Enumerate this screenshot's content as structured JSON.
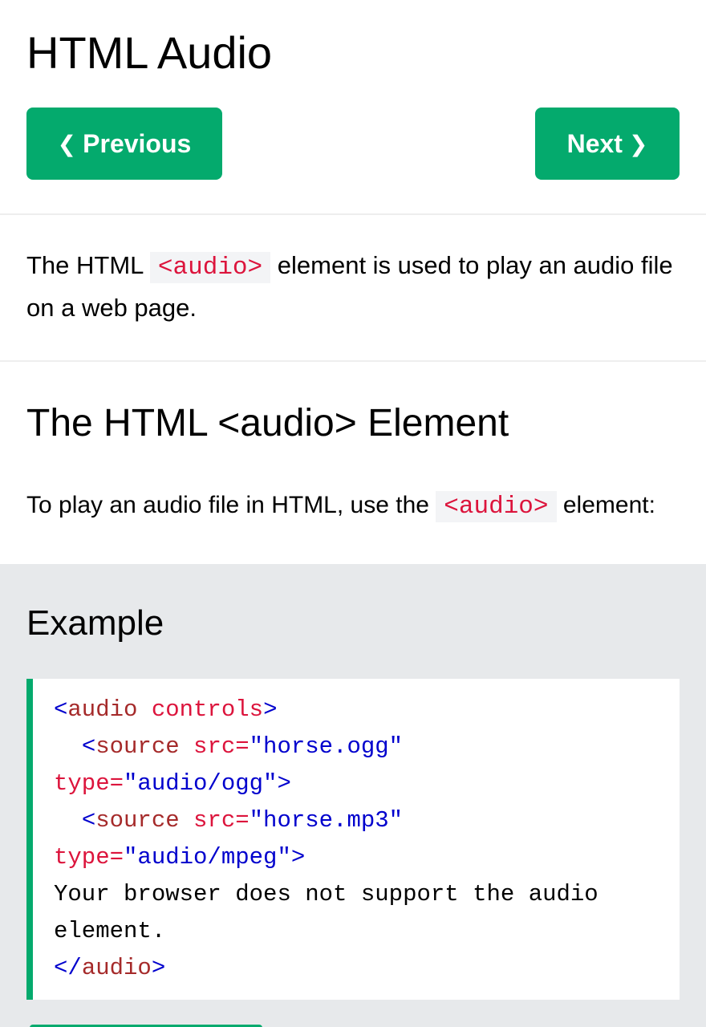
{
  "page": {
    "title": "HTML Audio"
  },
  "nav": {
    "prev_label": "Previous",
    "next_label": "Next",
    "prev_icon": "❮",
    "next_icon": "❯",
    "accent_color": "#04aa6d"
  },
  "intro": {
    "text_before": "The HTML",
    "code": "<audio>",
    "text_after": "element is used to play an audio file on a web page."
  },
  "section": {
    "title": "The HTML <audio> Element",
    "text_before": "To play an audio file in HTML, use the",
    "code": "<audio>",
    "text_after": "element:"
  },
  "example": {
    "title": "Example",
    "code_lines": {
      "l1": {
        "lt": "<",
        "tag": "audio",
        "attr": " controls",
        "gt": ">"
      },
      "l2": {
        "indent": "  ",
        "lt": "<",
        "tag": "source",
        "attr": " src=",
        "val": "\"horse.ogg\""
      },
      "l3": {
        "attr": "type=",
        "val": "\"audio/ogg\"",
        "gt": ">"
      },
      "l4": {
        "indent": "  ",
        "lt": "<",
        "tag": "source",
        "attr": " src=",
        "val": "\"horse.mp3\""
      },
      "l5": {
        "attr": "type=",
        "val": "\"audio/mpeg\"",
        "gt": ">"
      },
      "l6": {
        "text": "Your browser does not support the audio"
      },
      "l7": {
        "text": "element."
      },
      "l8": {
        "lt": "</",
        "tag": "audio",
        "gt": ">"
      }
    }
  }
}
